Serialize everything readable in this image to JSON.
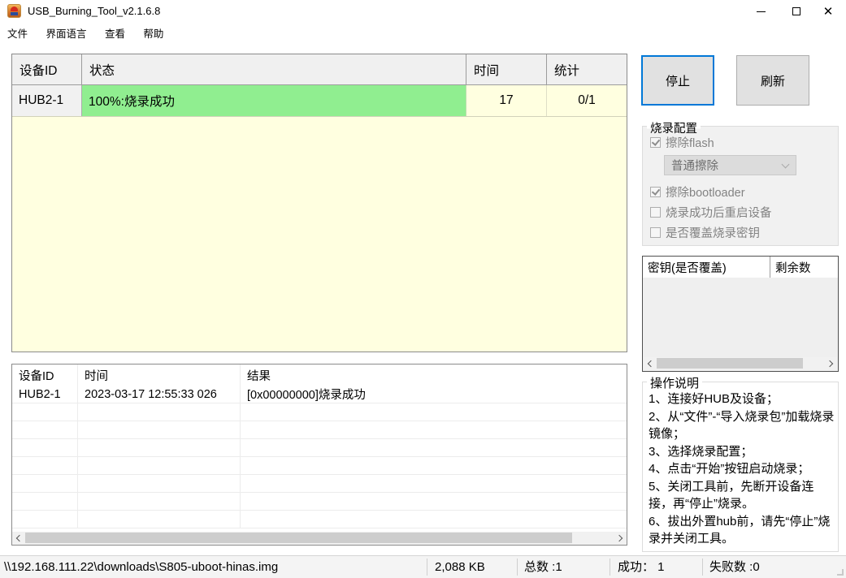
{
  "window": {
    "title": "USB_Burning_Tool_v2.1.6.8"
  },
  "menu": {
    "items": [
      {
        "label": "文件"
      },
      {
        "label": "界面语言"
      },
      {
        "label": "查看"
      },
      {
        "label": "帮助"
      }
    ]
  },
  "device_table": {
    "headers": {
      "device_id": "设备ID",
      "status": "状态",
      "time": "时间",
      "stats": "统计"
    },
    "row": {
      "device_id": "HUB2-1",
      "status": "100%:烧录成功",
      "time": "17",
      "stats": "0/1"
    }
  },
  "actions": {
    "stop": "停止",
    "refresh": "刷新"
  },
  "burn_config": {
    "title": "烧录配置",
    "erase_flash": "擦除flash",
    "erase_mode_selected": "普通擦除",
    "erase_bootloader": "擦除bootloader",
    "reboot_after_success": "烧录成功后重启设备",
    "overwrite_burn_key": "是否覆盖烧录密钥"
  },
  "key_table": {
    "header_key": "密钥(是否覆盖)",
    "header_remaining": "剩余数"
  },
  "instructions": {
    "title": "操作说明",
    "lines": [
      "1、连接好HUB及设备；",
      "2、从“文件”-“导入烧录包”加载烧录镜像；",
      "3、选择烧录配置；",
      "4、点击“开始”按钮启动烧录；",
      "5、关闭工具前，先断开设备连接，再“停止”烧录。",
      "6、拔出外置hub前，请先“停止”烧录并关闭工具。"
    ]
  },
  "log_table": {
    "headers": {
      "device_id": "设备ID",
      "time": "时间",
      "result": "结果"
    },
    "row": {
      "device_id": "HUB2-1",
      "time": "2023-03-17 12:55:33 026",
      "result": "[0x00000000]烧录成功"
    }
  },
  "status_bar": {
    "image_path": "\\\\192.168.111.22\\downloads\\S805-uboot-hinas.img",
    "image_size": "2,088 KB",
    "total": "总数 :1",
    "success": "成功： 1",
    "failed": "失败数 :0"
  },
  "icons": {
    "app_icon": "usb-burning-tool-logo",
    "minimize": "minimize-icon",
    "maximize": "maximize-icon",
    "close": "close-icon",
    "dropdown": "chevron-down-icon",
    "scroll_left": "chevron-left-icon",
    "scroll_right": "chevron-right-icon"
  },
  "colors": {
    "accent_blue": "#0078D7",
    "success_green": "#90EE90",
    "pending_yellow": "#FFFFE0",
    "button_face": "#E1E1E1",
    "disabled_text": "#838383"
  }
}
